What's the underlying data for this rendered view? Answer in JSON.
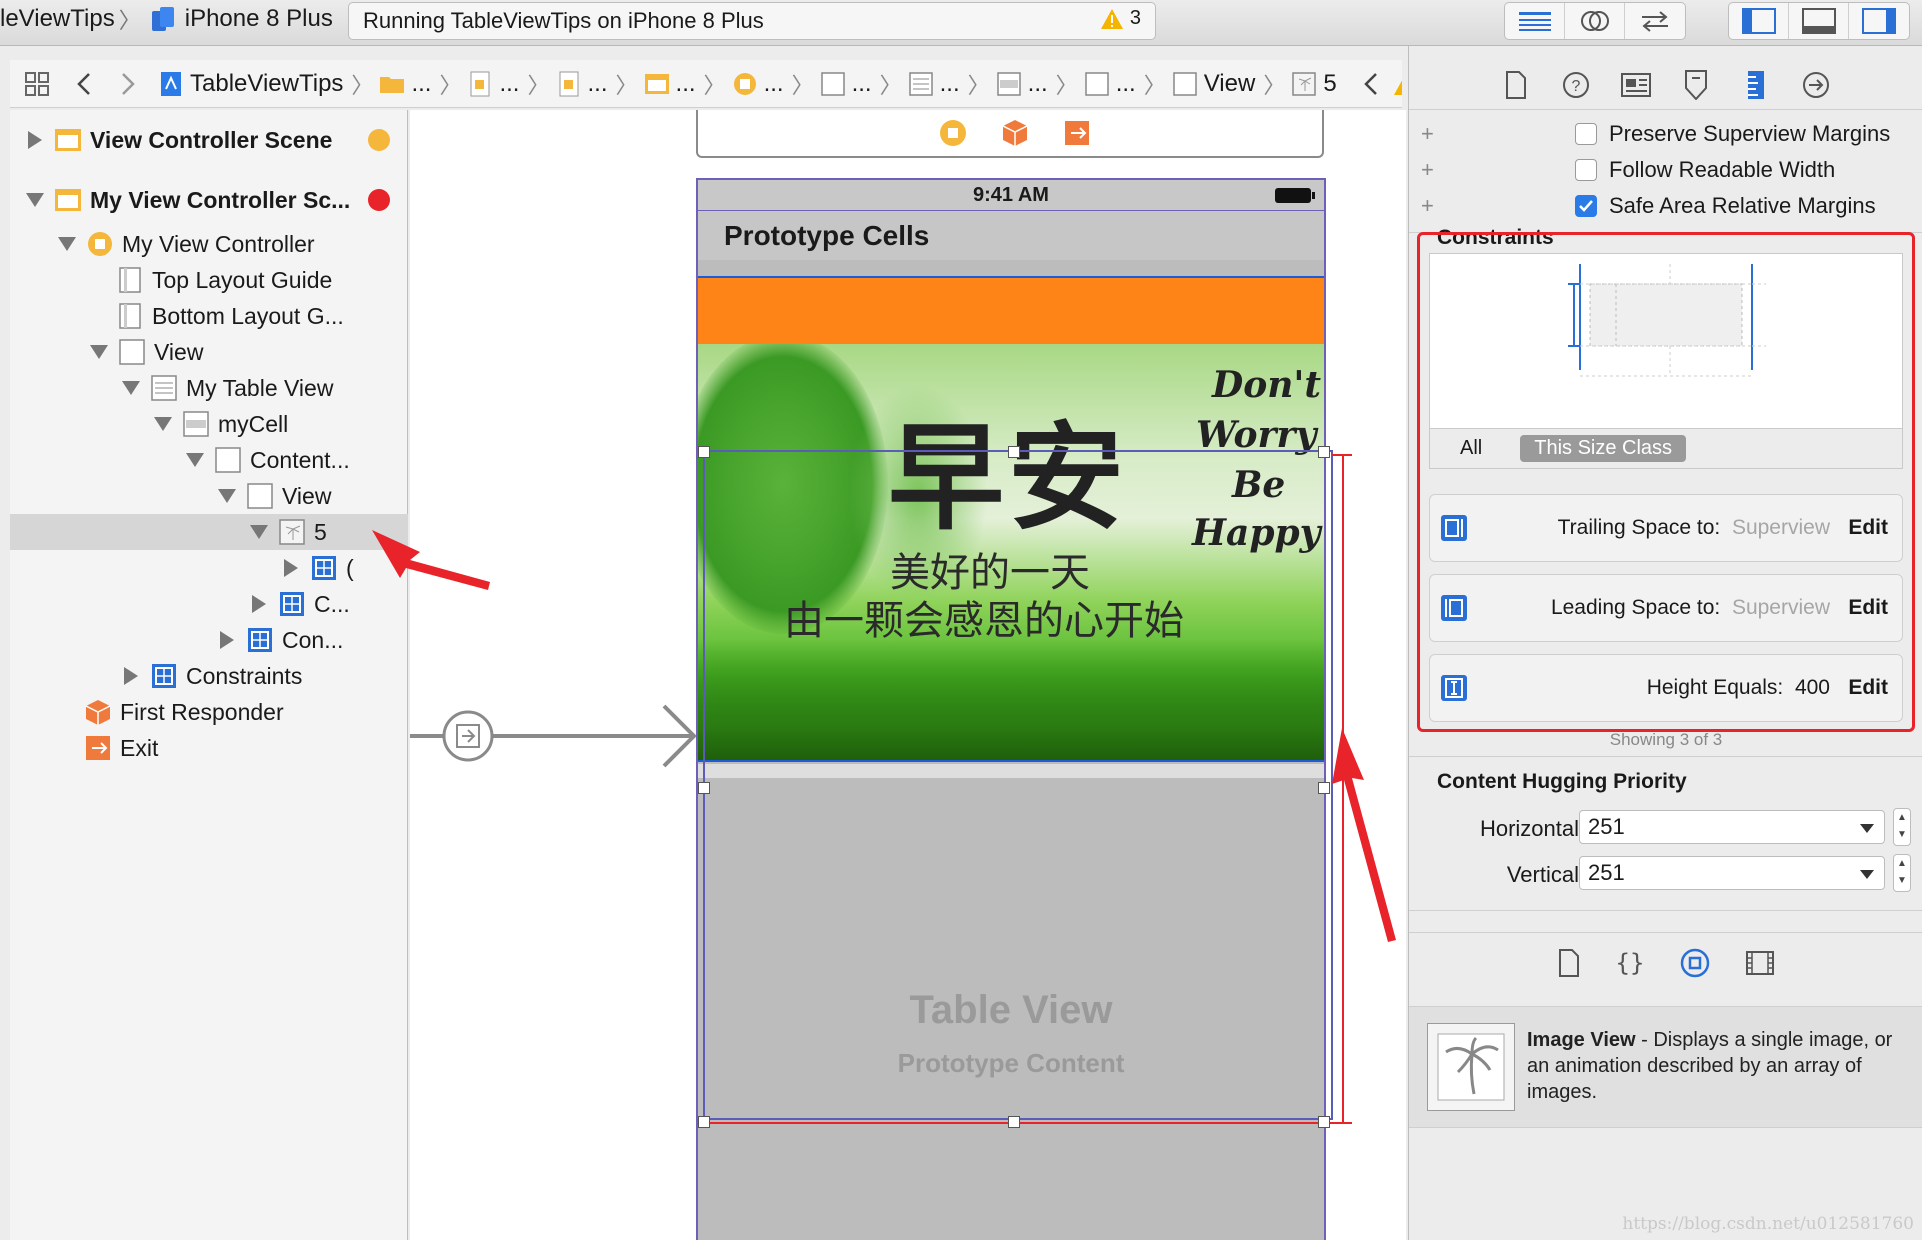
{
  "toolbar": {
    "scheme_name": "leViewTips",
    "device": "iPhone 8 Plus",
    "status": "Running TableViewTips on iPhone 8 Plus",
    "warning_count": "3"
  },
  "jumpbar": {
    "project": "TableViewTips",
    "ellipsis": "...",
    "view_label": "View",
    "current": "5"
  },
  "navigator": {
    "scene1": "View Controller Scene",
    "scene2": "My View Controller Sc...",
    "controller": "My View Controller",
    "top_guide": "Top Layout Guide",
    "bottom_guide": "Bottom Layout G...",
    "view": "View",
    "table_view": "My Table View",
    "cell": "myCell",
    "content": "Content...",
    "inner_view": "View",
    "image_node": "5",
    "child1": "(",
    "child2": "C...",
    "child3": "Con...",
    "constraints": "Constraints",
    "first_responder": "First Responder",
    "exit": "Exit"
  },
  "canvas": {
    "status_time": "9:41 AM",
    "prototype_cells": "Prototype Cells",
    "image": {
      "title": "早安",
      "line1": "美好的一天",
      "line2": "由一颗会感恩的心开始",
      "script1": "Don't",
      "script2": "Worry",
      "script3": "Be",
      "script4": "Happy"
    },
    "table_view_label": "Table View",
    "prototype_content": "Prototype Content"
  },
  "inspector": {
    "preserve_margins": "Preserve Superview Margins",
    "follow_readable": "Follow Readable Width",
    "safe_area": "Safe Area Relative Margins",
    "constraints_title": "Constraints",
    "tab_all": "All",
    "tab_size_class": "This Size Class",
    "constraints": [
      {
        "label": "Trailing Space to:",
        "target": "Superview",
        "edit": "Edit"
      },
      {
        "label": "Leading Space to:",
        "target": "Superview",
        "edit": "Edit"
      },
      {
        "label": "Height Equals:",
        "target": "400",
        "edit": "Edit"
      }
    ],
    "showing": "Showing 3 of 3",
    "hugging_title": "Content Hugging Priority",
    "horizontal_label": "Horizontal",
    "horizontal_value": "251",
    "vertical_label": "Vertical",
    "vertical_value": "251",
    "library": {
      "title": "Image View",
      "desc": " - Displays a single image, or an animation described by an array of images."
    }
  },
  "watermark": "https://blog.csdn.net/u012581760",
  "colors": {
    "accent": "#2a7be8",
    "annotation_red": "#e8232a",
    "orange": "#ff8418",
    "selection": "#d6d6d6"
  }
}
